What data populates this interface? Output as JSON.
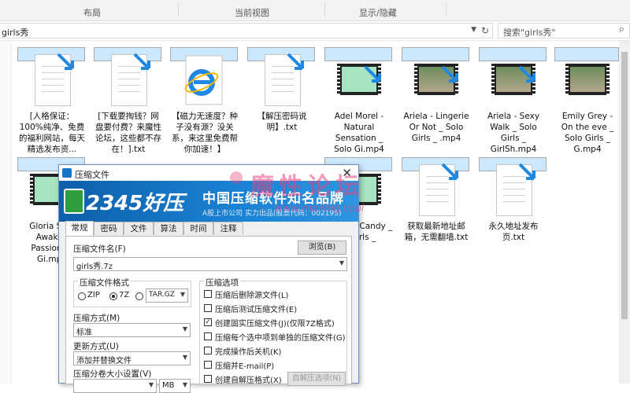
{
  "ribbon": {
    "tabs": [
      "布局",
      "当前视图",
      "显示/隐藏"
    ]
  },
  "address": {
    "path": "girls秀",
    "dropdown_icon": "chevron-down-icon",
    "refresh_icon": "refresh-icon"
  },
  "search": {
    "placeholder": "搜索\"girls秀\"",
    "icon": "search-icon"
  },
  "files_row1": [
    {
      "name": "[人格保证：100%纯净、免费的福利网站，每天精选发布资...",
      "type": "doc"
    },
    {
      "name": "[下载要掏钱？网盘要付费？来魔性论坛，这些都不存在！].txt",
      "type": "doc"
    },
    {
      "name": "【磁力无速度？种子没有源？没关系，来这里免费帮你加速！】",
      "type": "ie"
    },
    {
      "name": "【解压密码说明】.txt",
      "type": "doc"
    },
    {
      "name": "Adel Morel - Natural Sensation _ Solo Gi.mp4",
      "type": "video"
    },
    {
      "name": "Ariela - Lingerie Or Not _ Solo Girls _ .mp4",
      "type": "video-pic"
    },
    {
      "name": "Ariela - Sexy Walk _ Solo Girls _ GirlSh.mp4",
      "type": "video-pic"
    },
    {
      "name": "Emily Grey - On the eve _ Solo Girls _ G.mp4",
      "type": "video-pic"
    }
  ],
  "files_row2": [
    {
      "name": "Gloria Sol - Awaken Passions _ Gi.mp4",
      "type": "video"
    },
    {
      "name": "Azul - Candy _ Girls _",
      "type": "video"
    },
    {
      "name": "获取最新地址邮箱，无需翻墙.txt",
      "type": "doc"
    },
    {
      "name": "永久地址发布页.txt",
      "type": "doc"
    }
  ],
  "dialog": {
    "title": "压缩文件",
    "brand": "2345好压",
    "slogan": "中国压缩软件知名品牌",
    "sub": "A股上市公司 实力出品(股票代码：002195)",
    "tabs": [
      "常规",
      "密码",
      "文件",
      "算法",
      "时间",
      "注释"
    ],
    "file_label": "压缩文件名(F)",
    "browse": "浏览(B)",
    "file_value": "girls秀.7z",
    "format_group": "压缩文件格式",
    "formats": [
      "ZIP",
      "7Z",
      "TAR.GZ"
    ],
    "selected_format": "7Z",
    "method_label": "压缩方式(M)",
    "method_value": "标准",
    "update_label": "更新方式(U)",
    "update_value": "添加并替换文件",
    "split_label": "压缩分卷大小设置(V)",
    "split_unit": "MB",
    "options_group": "压缩选项",
    "options": [
      {
        "label": "压缩后删除源文件(L)",
        "checked": false
      },
      {
        "label": "压缩后测试压缩文件(E)",
        "checked": false
      },
      {
        "label": "创建固实压缩文件(J)(仅限7Z格式)",
        "checked": true
      },
      {
        "label": "压缩每个选中项到单独的压缩文件(G)",
        "checked": false
      },
      {
        "label": "完成操作后关机(K)",
        "checked": false
      },
      {
        "label": "压缩并E-mail(P)",
        "checked": false
      },
      {
        "label": "创建自解压格式(X)",
        "checked": false
      }
    ],
    "sfx_button": "自解压选项(N)",
    "close_icon": "close-icon"
  },
  "watermark": {
    "text": "魔性论坛",
    "url": "www.moxing.cool"
  }
}
